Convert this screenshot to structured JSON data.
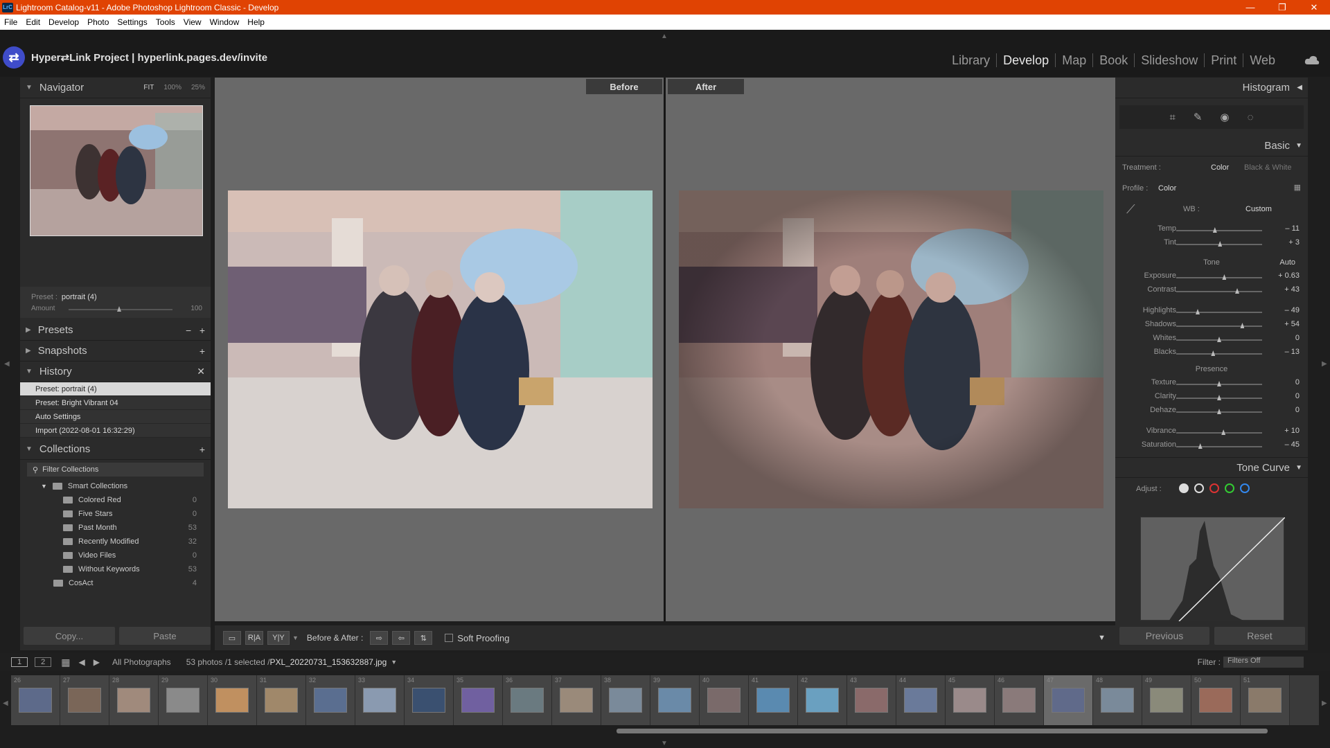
{
  "window": {
    "title": "Lightroom Catalog-v11 - Adobe Photoshop Lightroom Classic - Develop",
    "app_icon": "LrC",
    "minimize": "—",
    "maximize": "❐",
    "close": "✕"
  },
  "menu": [
    "File",
    "Edit",
    "Develop",
    "Photo",
    "Settings",
    "Tools",
    "View",
    "Window",
    "Help"
  ],
  "identity_plate": "Hyper⇄Link Project | hyperlink.pages.dev/invite",
  "modules": [
    "Library",
    "Develop",
    "Map",
    "Book",
    "Slideshow",
    "Print",
    "Web"
  ],
  "active_module": "Develop",
  "navigator": {
    "title": "Navigator",
    "zoom_options": [
      "FIT",
      "100%",
      "25%"
    ],
    "preset_label": "Preset :",
    "preset_value": "portrait (4)",
    "amount_label": "Amount",
    "amount_value": "100",
    "amount_fraction": 0.5
  },
  "left_sections": {
    "presets": "Presets",
    "snapshots": "Snapshots",
    "history": "History",
    "collections": "Collections"
  },
  "history": [
    "Preset: portrait (4)",
    "Preset: Bright Vibrant 04",
    "Auto Settings",
    "Import (2022-08-01 16:32:29)"
  ],
  "collections": {
    "filter_placeholder": "Filter Collections",
    "smart_collections": "Smart Collections",
    "items": [
      {
        "name": "Colored Red",
        "count": "0"
      },
      {
        "name": "Five Stars",
        "count": "0"
      },
      {
        "name": "Past Month",
        "count": "53"
      },
      {
        "name": "Recently Modified",
        "count": "32"
      },
      {
        "name": "Video Files",
        "count": "0"
      },
      {
        "name": "Without Keywords",
        "count": "53"
      }
    ],
    "cosact": {
      "name": "CosAct",
      "count": "4"
    }
  },
  "buttons": {
    "copy": "Copy...",
    "paste": "Paste",
    "previous": "Previous",
    "reset": "Reset"
  },
  "view": {
    "before": "Before",
    "after": "After"
  },
  "toolbar": {
    "before_after_label": "Before & After :",
    "soft_proofing": "Soft Proofing",
    "yy": "Y|Y"
  },
  "right": {
    "histogram": "Histogram",
    "basic": "Basic",
    "treatment_label": "Treatment :",
    "treatment_color": "Color",
    "treatment_bw": "Black & White",
    "profile_label": "Profile :",
    "profile_value": "Color",
    "wb_label": "WB :",
    "wb_value": "Custom",
    "tone": "Tone",
    "auto": "Auto",
    "presence": "Presence",
    "tone_curve": "Tone Curve",
    "adjust": "Adjust :"
  },
  "sliders": {
    "wb": [
      {
        "name": "Temp",
        "value": "– 11",
        "pos": 0.45
      },
      {
        "name": "Tint",
        "value": "+ 3",
        "pos": 0.51
      }
    ],
    "tone": [
      {
        "name": "Exposure",
        "value": "+ 0.63",
        "pos": 0.56
      },
      {
        "name": "Contrast",
        "value": "+ 43",
        "pos": 0.71
      }
    ],
    "tone2": [
      {
        "name": "Highlights",
        "value": "– 49",
        "pos": 0.25
      },
      {
        "name": "Shadows",
        "value": "+ 54",
        "pos": 0.77
      },
      {
        "name": "Whites",
        "value": "0",
        "pos": 0.5
      },
      {
        "name": "Blacks",
        "value": "– 13",
        "pos": 0.43
      }
    ],
    "presence": [
      {
        "name": "Texture",
        "value": "0",
        "pos": 0.5
      },
      {
        "name": "Clarity",
        "value": "0",
        "pos": 0.5
      },
      {
        "name": "Dehaze",
        "value": "0",
        "pos": 0.5
      }
    ],
    "presence2": [
      {
        "name": "Vibrance",
        "value": "+ 10",
        "pos": 0.55
      },
      {
        "name": "Saturation",
        "value": "– 45",
        "pos": 0.28
      }
    ]
  },
  "filmstrip": {
    "source": "All Photographs",
    "count_text": "53 photos /1 selected /",
    "filename": "PXL_20220731_153632887.jpg",
    "filter_label": "Filter :",
    "filter_value": "Filters Off",
    "numbers": [
      "26",
      "27",
      "28",
      "29",
      "30",
      "31",
      "32",
      "33",
      "34",
      "35",
      "36",
      "37",
      "38",
      "39",
      "40",
      "41",
      "42",
      "43",
      "44",
      "45",
      "46",
      "47",
      "48",
      "49",
      "50",
      "51"
    ],
    "selected_index": 21
  },
  "colors": {
    "titlebar": "#e04303",
    "panel": "#2b2b2b",
    "center": "#696969"
  }
}
